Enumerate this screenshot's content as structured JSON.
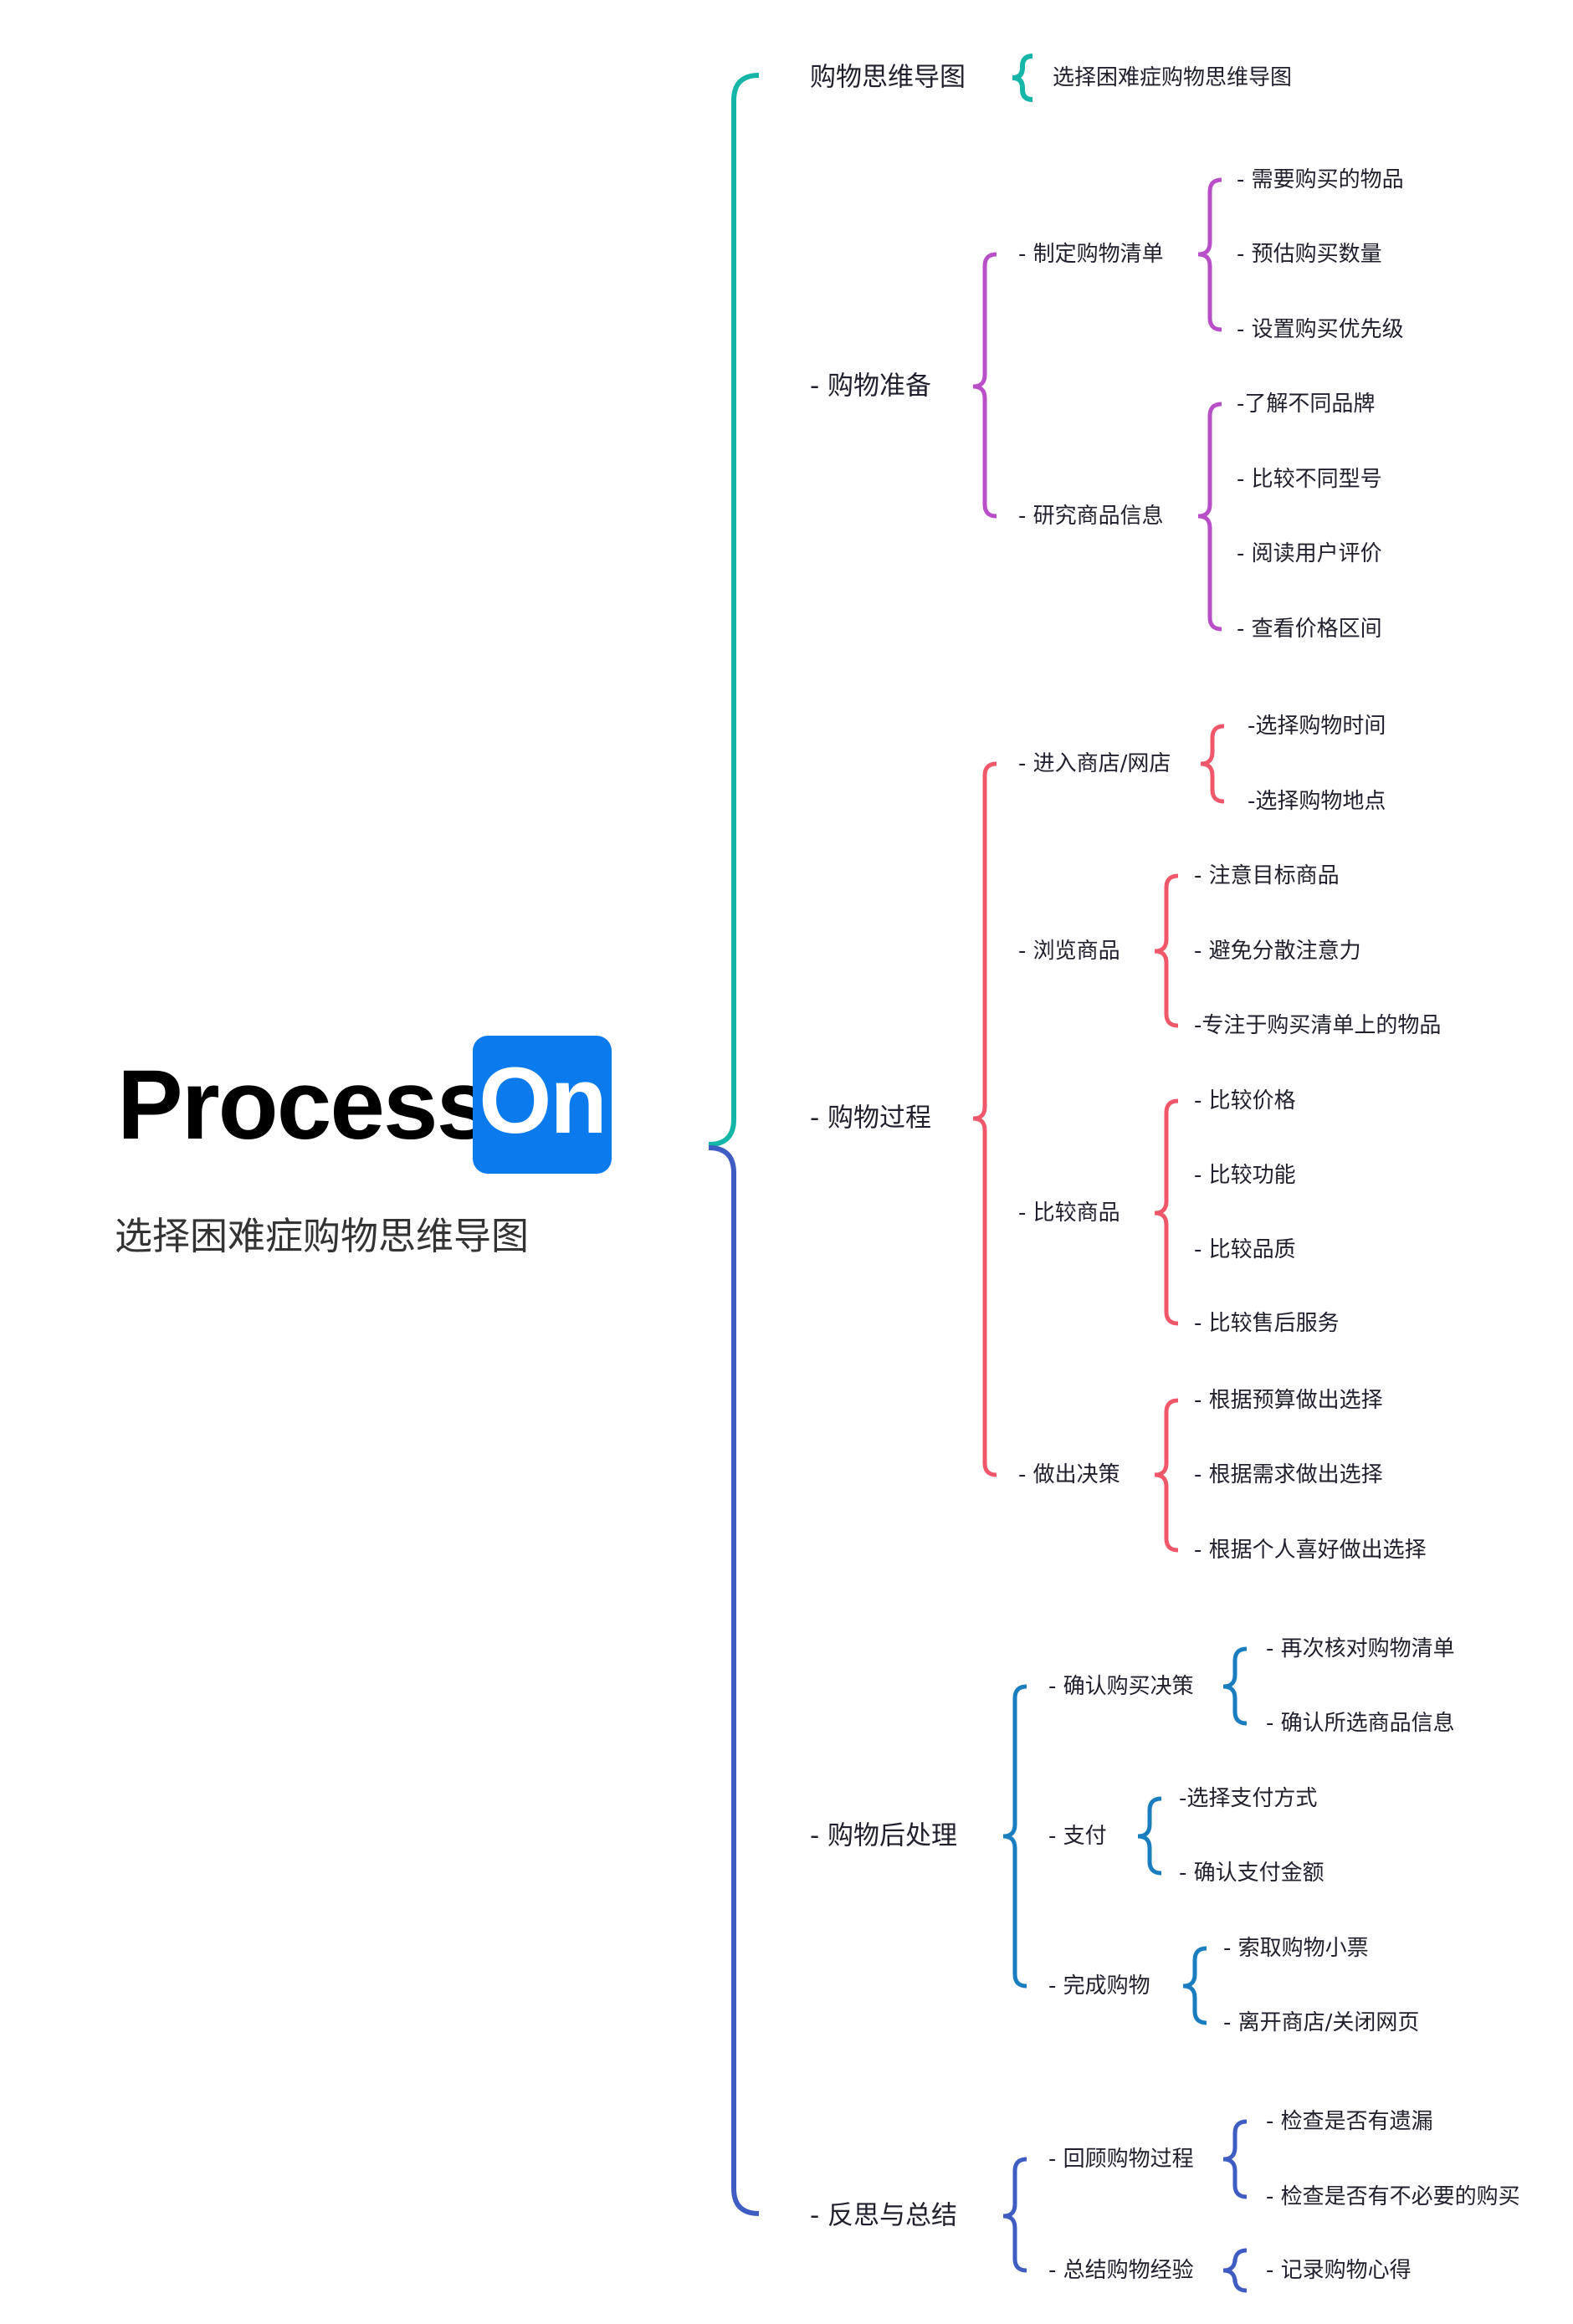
{
  "logo": {
    "word": "Process",
    "badge": "On",
    "badge_color": "#0a7aed"
  },
  "subtitle": "选择困难症购物思维导图",
  "colors": {
    "teal": "#15b5a8",
    "blue": "#3f5cc2",
    "purple": "#b84fc8",
    "red": "#f0576a",
    "steel": "#1a7dbf"
  },
  "branches": [
    {
      "label": "购物思维导图",
      "children": [
        {
          "label": "选择困难症购物思维导图",
          "children": []
        }
      ]
    },
    {
      "label": "- 购物准备",
      "children": [
        {
          "label": "- 制定购物清单",
          "children": [
            {
              "label": "- 需要购买的物品"
            },
            {
              "label": "- 预估购买数量"
            },
            {
              "label": "- 设置购买优先级"
            }
          ]
        },
        {
          "label": "- 研究商品信息",
          "children": [
            {
              "label": "-了解不同品牌"
            },
            {
              "label": "- 比较不同型号"
            },
            {
              "label": "- 阅读用户评价"
            },
            {
              "label": "- 查看价格区间"
            }
          ]
        }
      ]
    },
    {
      "label": "- 购物过程",
      "children": [
        {
          "label": "- 进入商店/网店",
          "children": [
            {
              "label": "-选择购物时间"
            },
            {
              "label": "-选择购物地点"
            }
          ]
        },
        {
          "label": "- 浏览商品",
          "children": [
            {
              "label": "- 注意目标商品"
            },
            {
              "label": "- 避免分散注意力"
            },
            {
              "label": "-专注于购买清单上的物品"
            }
          ]
        },
        {
          "label": "- 比较商品",
          "children": [
            {
              "label": "- 比较价格"
            },
            {
              "label": "- 比较功能"
            },
            {
              "label": "- 比较品质"
            },
            {
              "label": "- 比较售后服务"
            }
          ]
        },
        {
          "label": "- 做出决策",
          "children": [
            {
              "label": "- 根据预算做出选择"
            },
            {
              "label": "- 根据需求做出选择"
            },
            {
              "label": "- 根据个人喜好做出选择"
            }
          ]
        }
      ]
    },
    {
      "label": "- 购物后处理",
      "children": [
        {
          "label": "- 确认购买决策",
          "children": [
            {
              "label": "- 再次核对购物清单"
            },
            {
              "label": "- 确认所选商品信息"
            }
          ]
        },
        {
          "label": "- 支付",
          "children": [
            {
              "label": "-选择支付方式"
            },
            {
              "label": "- 确认支付金额"
            }
          ]
        },
        {
          "label": "- 完成购物",
          "children": [
            {
              "label": "- 索取购物小票"
            },
            {
              "label": "- 离开商店/关闭网页"
            }
          ]
        }
      ]
    },
    {
      "label": "- 反思与总结",
      "children": [
        {
          "label": "- 回顾购物过程",
          "children": [
            {
              "label": "- 检查是否有遗漏"
            },
            {
              "label": "- 检查是否有不必要的购买"
            }
          ]
        },
        {
          "label": "- 总结购物经验",
          "children": [
            {
              "label": "- 记录购物心得"
            }
          ]
        }
      ]
    }
  ]
}
